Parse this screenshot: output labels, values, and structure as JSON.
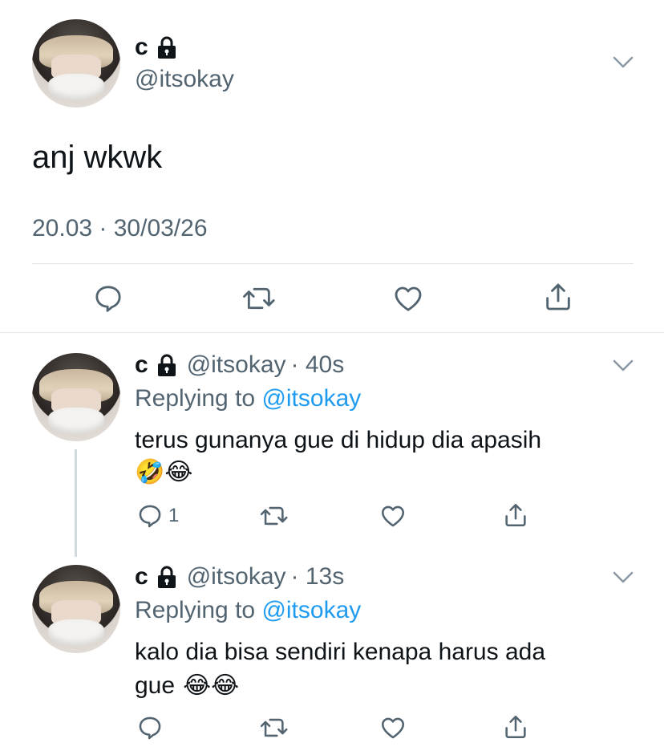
{
  "main_tweet": {
    "name": "c",
    "handle": "@itsokay",
    "text": "anj wkwk",
    "timestamp": "20.03 · 30/03/26"
  },
  "replies": [
    {
      "name": "c",
      "handle": "@itsokay",
      "age": "· 40s",
      "replying_label": "Replying to",
      "replying_to": "@itsokay",
      "text": "terus gunanya gue di hidup dia apasih",
      "emojis": "🤣😂",
      "reply_count": "1"
    },
    {
      "name": "c",
      "handle": "@itsokay",
      "age": "· 13s",
      "replying_label": "Replying to",
      "replying_to": "@itsokay",
      "text_line1": "kalo dia bisa sendiri kenapa harus ada",
      "text_line2": "gue",
      "emojis": "😂😂"
    }
  ],
  "colors": {
    "icon_gray": "#536471",
    "link_blue": "#1d9bf0",
    "divider": "#e1e6ea"
  },
  "icons": [
    "reply-icon",
    "retweet-icon",
    "like-icon",
    "share-icon",
    "lock-icon",
    "chevron-down-icon"
  ]
}
